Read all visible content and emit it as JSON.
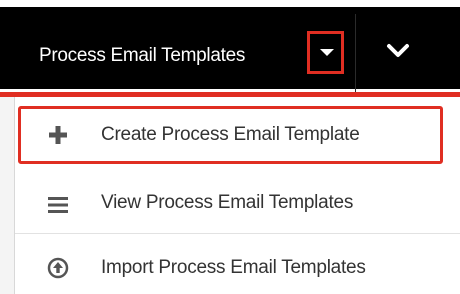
{
  "navbar": {
    "module_title": "Process Email Templates"
  },
  "menu": {
    "items": [
      {
        "label": "Create Process Email Template",
        "icon": "plus-icon"
      },
      {
        "label": "View Process Email Templates",
        "icon": "list-icon"
      },
      {
        "label": "Import Process Email Templates",
        "icon": "upload-circle-icon"
      }
    ]
  },
  "colors": {
    "navbar_bg": "#000000",
    "accent_red": "#e02e22",
    "menu_text": "#333333",
    "icon_gray": "#555555"
  }
}
